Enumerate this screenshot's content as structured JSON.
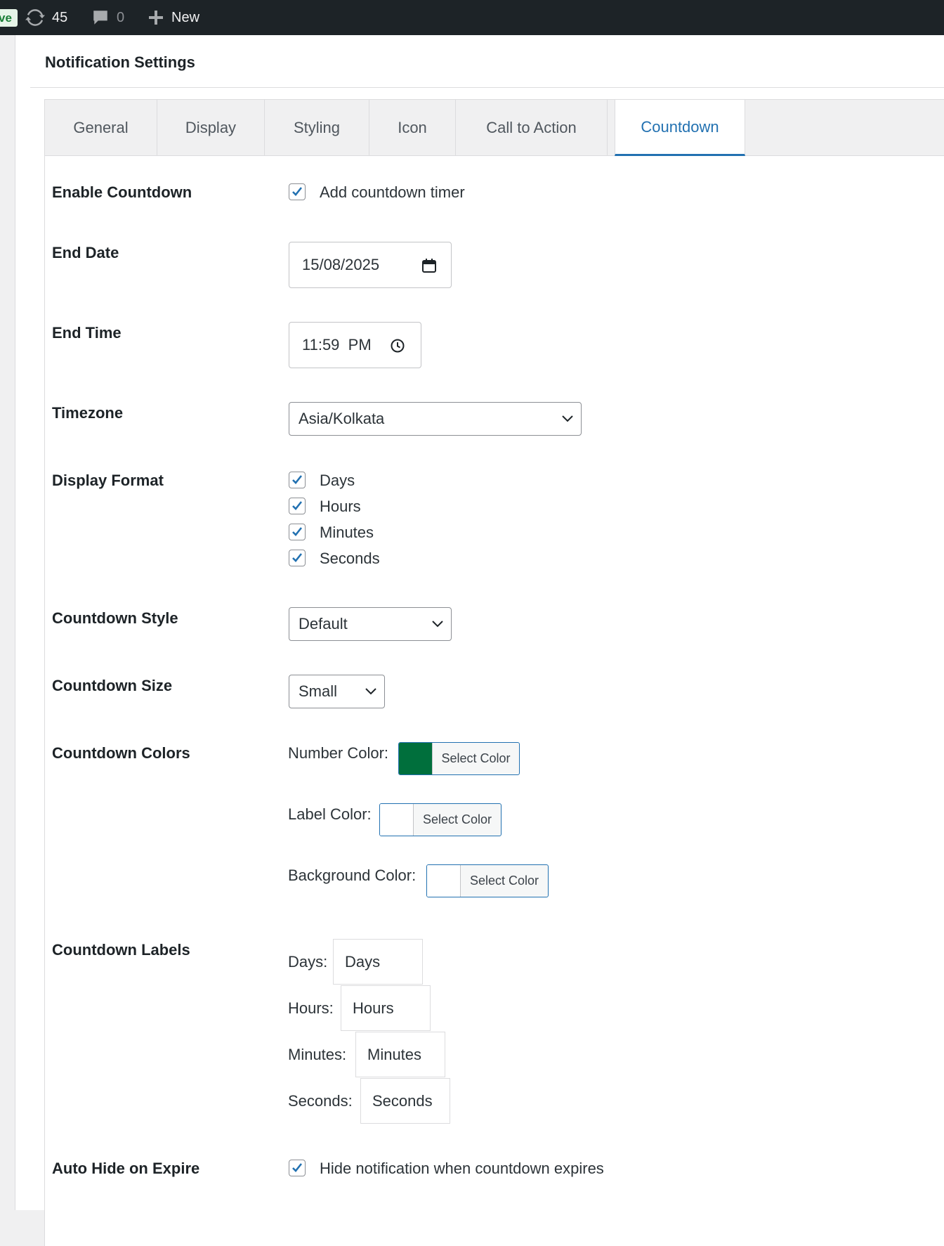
{
  "adminbar": {
    "site_badge": "ve",
    "updates_count": "45",
    "comments_count": "0",
    "new_label": "New"
  },
  "section_title": "Notification Settings",
  "tabs": [
    {
      "label": "General"
    },
    {
      "label": "Display"
    },
    {
      "label": "Styling"
    },
    {
      "label": "Icon"
    },
    {
      "label": "Call to Action"
    },
    {
      "label": "Countdown",
      "active": true
    }
  ],
  "settings": {
    "enable_countdown": {
      "label": "Enable Countdown",
      "checkbox_label": "Add countdown timer",
      "checked": true
    },
    "end_date": {
      "label": "End Date",
      "value": "15/08/2025"
    },
    "end_time": {
      "label": "End Time",
      "value": "11:59  PM"
    },
    "timezone": {
      "label": "Timezone",
      "value": "Asia/Kolkata"
    },
    "display_format": {
      "label": "Display Format",
      "options": [
        {
          "label": "Days",
          "checked": true
        },
        {
          "label": "Hours",
          "checked": true
        },
        {
          "label": "Minutes",
          "checked": true
        },
        {
          "label": "Seconds",
          "checked": true
        }
      ]
    },
    "countdown_style": {
      "label": "Countdown Style",
      "value": "Default"
    },
    "countdown_size": {
      "label": "Countdown Size",
      "value": "Small"
    },
    "countdown_colors": {
      "label": "Countdown Colors",
      "number": {
        "label": "Number Color:",
        "button": "Select Color",
        "color": "#006f3c"
      },
      "label_color": {
        "label": "Label Color:",
        "button": "Select Color",
        "color": "#ffffff"
      },
      "background": {
        "label": "Background Color:",
        "button": "Select Color",
        "color": "#ffffff"
      }
    },
    "countdown_labels": {
      "label": "Countdown Labels",
      "days": {
        "label": "Days:",
        "value": "Days"
      },
      "hours": {
        "label": "Hours:",
        "value": "Hours"
      },
      "minutes": {
        "label": "Minutes:",
        "value": "Minutes"
      },
      "seconds": {
        "label": "Seconds:",
        "value": "Seconds"
      }
    },
    "auto_hide": {
      "label": "Auto Hide on Expire",
      "checkbox_label": "Hide notification when countdown expires",
      "checked": true
    }
  },
  "accent_color": "#2271b1"
}
